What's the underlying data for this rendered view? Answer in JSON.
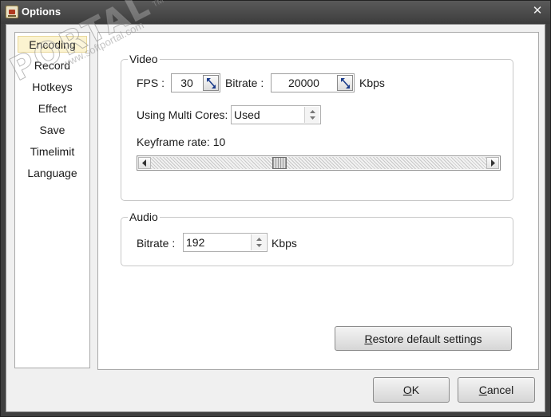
{
  "window": {
    "title": "Options",
    "close_label": "✕"
  },
  "nav": {
    "items": [
      {
        "label": "Encoding",
        "selected": true
      },
      {
        "label": "Record"
      },
      {
        "label": "Hotkeys"
      },
      {
        "label": "Effect"
      },
      {
        "label": "Save"
      },
      {
        "label": "Timelimit"
      },
      {
        "label": "Language"
      }
    ]
  },
  "video": {
    "group_title": "Video",
    "fps_label": "FPS :",
    "fps_value": "30",
    "bitrate_label": "Bitrate :",
    "bitrate_value": "20000",
    "bitrate_unit": "Kbps",
    "multicore_label": "Using Multi Cores:",
    "multicore_value": "Used",
    "keyframe_label": "Keyframe rate: 10",
    "keyframe_value": 10
  },
  "audio": {
    "group_title": "Audio",
    "bitrate_label": "Bitrate :",
    "bitrate_value": "192",
    "bitrate_unit": "Kbps"
  },
  "buttons": {
    "restore_first": "R",
    "restore_rest": "estore default settings",
    "ok_first": "O",
    "ok_rest": "K",
    "cancel_first": "C",
    "cancel_rest": "ancel"
  },
  "watermark": {
    "big": "PORTAL",
    "trademark": "TM",
    "small": "www.softportal.com"
  },
  "icons": {
    "app": "app-icon",
    "close": "close-icon",
    "spin": "spin-arrows-icon",
    "combo": "combo-arrows-icon",
    "slider_left": "arrow-left-icon",
    "slider_right": "arrow-right-icon"
  }
}
